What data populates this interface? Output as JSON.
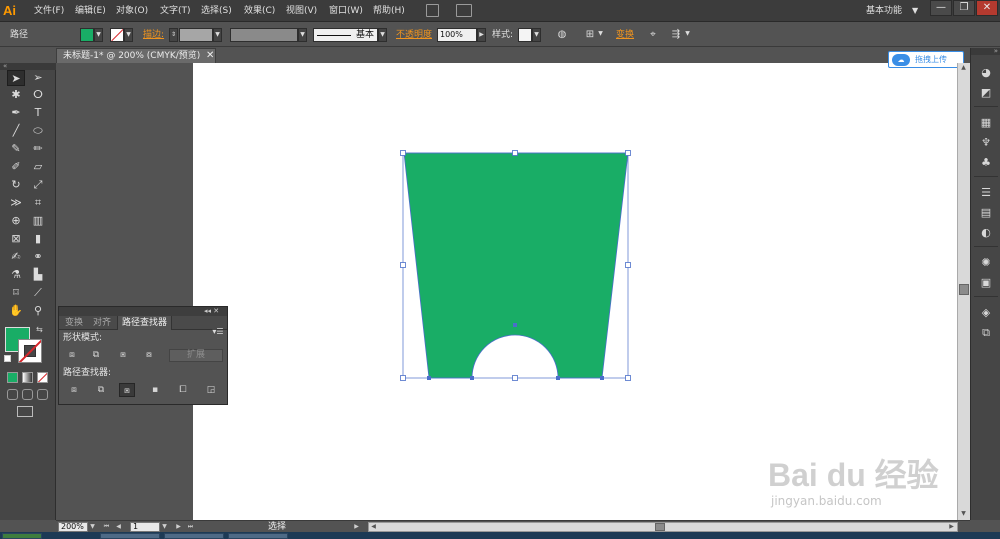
{
  "app": {
    "logo": "Ai",
    "workspace": "基本功能"
  },
  "menu": [
    "文件(F)",
    "编辑(E)",
    "对象(O)",
    "文字(T)",
    "选择(S)",
    "效果(C)",
    "视图(V)",
    "窗口(W)",
    "帮助(H)"
  ],
  "window_controls": {
    "minimize": "—",
    "restore": "❐",
    "close": "✕"
  },
  "control_bar": {
    "object_type": "路径",
    "fill_color": "#19ad66",
    "stroke_label": "描边:",
    "brush_label": "基本",
    "opacity_label": "不透明度",
    "opacity_value": "100%",
    "style_label": "样式:",
    "transform_label": "变换"
  },
  "document": {
    "tab_title": "未标题-1* @ 200% (CMYK/预览)",
    "close": "✕"
  },
  "upload_badge": {
    "text": "拖拽上传"
  },
  "pathfinder_panel": {
    "tabs": [
      "变换",
      "对齐",
      "路径查找器"
    ],
    "active_tab": 2,
    "shape_modes_label": "形状模式:",
    "pathfinders_label": "路径查找器:",
    "expand_label": "扩展"
  },
  "status_bar": {
    "zoom": "200%",
    "page": "1",
    "tool": "选择"
  },
  "shape": {
    "fill": "#19ad66",
    "selection_color": "#4a6fc9"
  },
  "watermark": {
    "text": "Bai du 经验",
    "url": "jingyan.baidu.com"
  }
}
